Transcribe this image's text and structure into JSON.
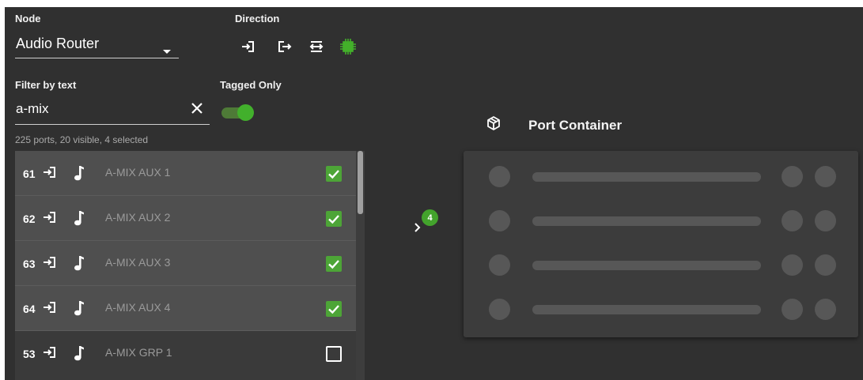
{
  "node": {
    "label": "Node",
    "value": "Audio Router"
  },
  "direction": {
    "label": "Direction",
    "buttons": [
      "input-icon",
      "output-icon",
      "bidirectional-icon",
      "all-directions-icon"
    ],
    "active_color": "#43b02a"
  },
  "filter": {
    "label": "Filter by text",
    "value": "a-mix"
  },
  "tagged_only": {
    "label": "Tagged Only",
    "on": true
  },
  "port_count_text": "225 ports, 20 visible, 4 selected",
  "ports": [
    {
      "number": "61",
      "direction_icon": "input-icon",
      "type_icon": "music-note-icon",
      "name": "A-MIX AUX 1",
      "selected": true
    },
    {
      "number": "62",
      "direction_icon": "input-icon",
      "type_icon": "music-note-icon",
      "name": "A-MIX AUX 2",
      "selected": true
    },
    {
      "number": "63",
      "direction_icon": "input-icon",
      "type_icon": "music-note-icon",
      "name": "A-MIX AUX 3",
      "selected": true
    },
    {
      "number": "64",
      "direction_icon": "input-icon",
      "type_icon": "music-note-icon",
      "name": "A-MIX AUX 4",
      "selected": true
    },
    {
      "number": "53",
      "direction_icon": "input-icon",
      "type_icon": "music-note-icon",
      "name": "A-MIX GRP 1",
      "selected": false
    }
  ],
  "selection_badge": "4",
  "port_container": {
    "title": "Port Container",
    "icon": "cube-icon",
    "placeholder_rows": 4
  },
  "colors": {
    "accent": "#43a32c",
    "background": "#303030"
  }
}
